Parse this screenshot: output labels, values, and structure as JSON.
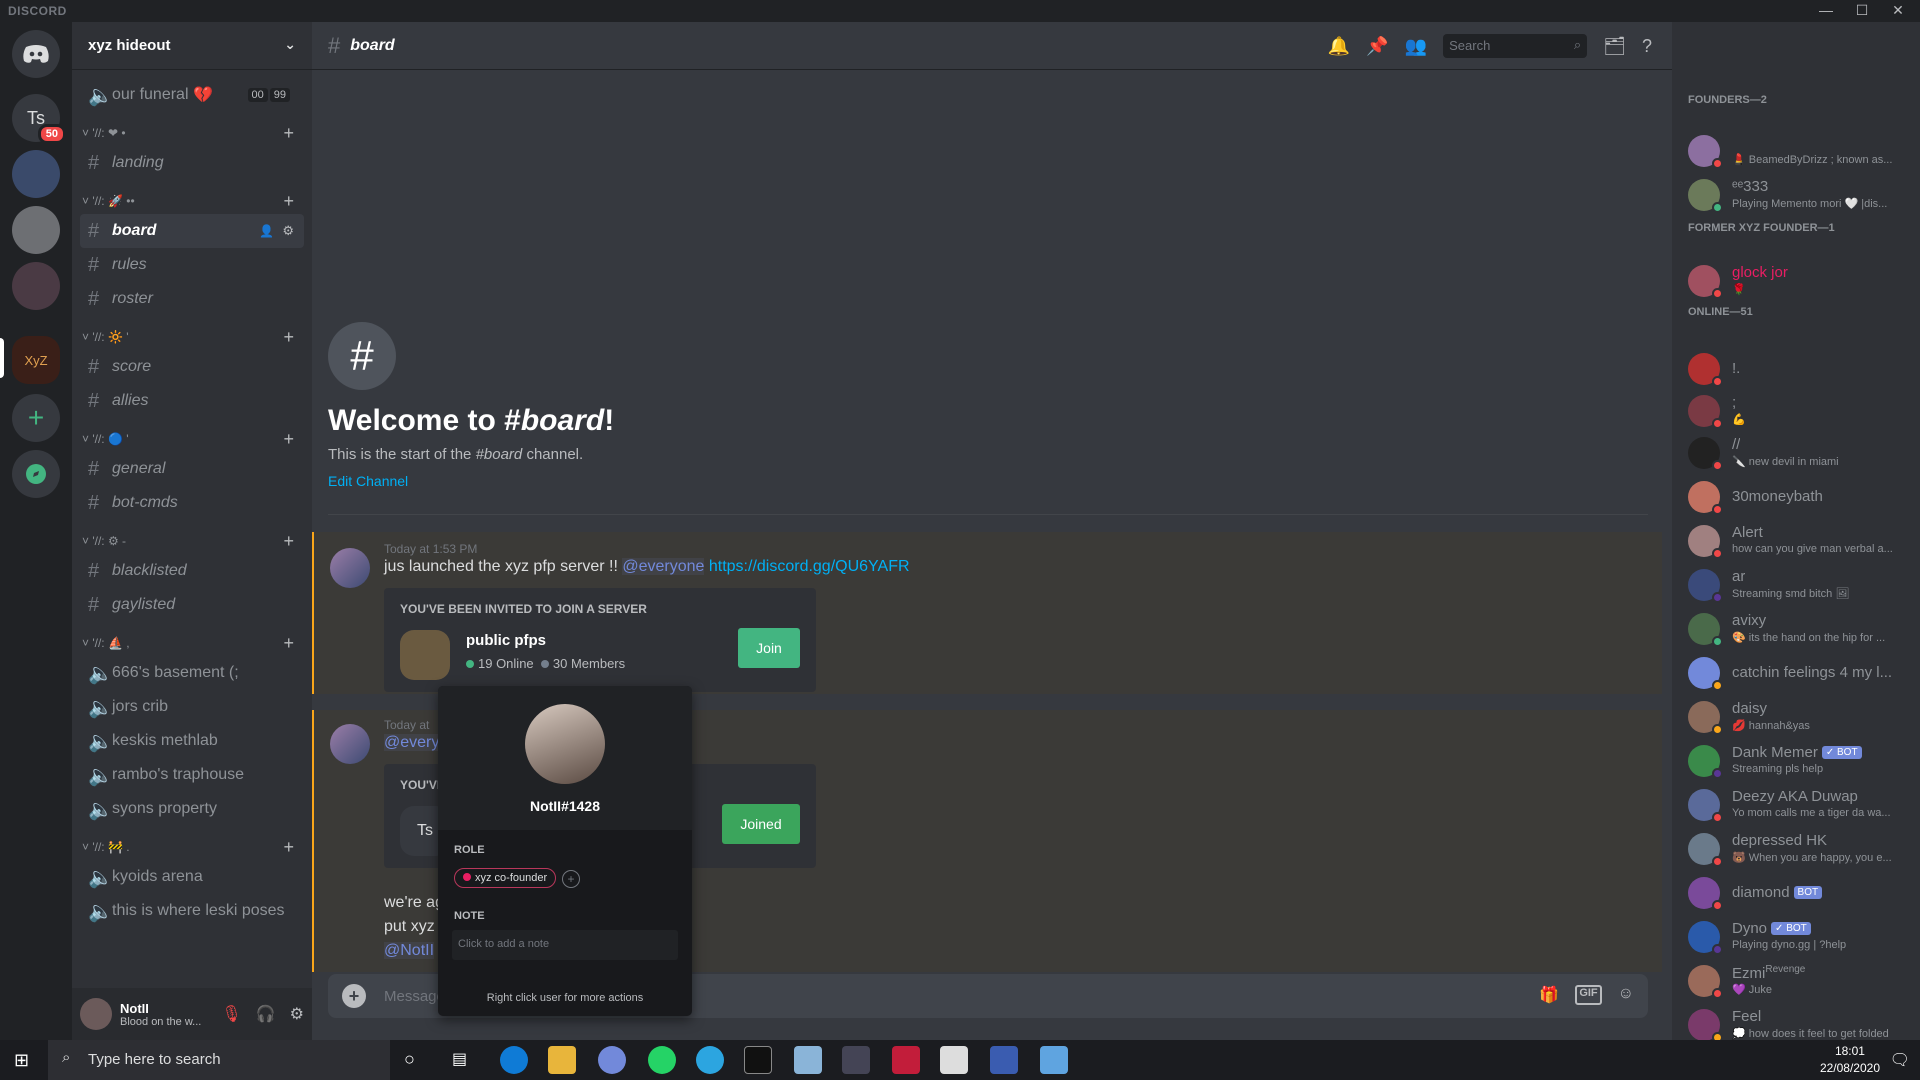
{
  "titlebar": {
    "brand": "DISCORD",
    "min": "—",
    "max": "☐",
    "close": "✕"
  },
  "guilds": {
    "home_icon": "discord-logo",
    "ts_label": "Ts",
    "ts_badge": "50",
    "add": "+",
    "explore": "⌖"
  },
  "server": {
    "name": "xyz hideout",
    "chevron": "⌄"
  },
  "channels": {
    "top_voice": {
      "name": "our funeral",
      "emoji": "💔",
      "counts": [
        "00",
        "99"
      ]
    },
    "cat1": {
      "label": "˅ '//: ❤ •",
      "plus": "+"
    },
    "landing": "landing",
    "cat2": {
      "label": "˅ '//: 🚀 ••",
      "plus": "+"
    },
    "board": "board",
    "rules": "rules",
    "roster": "roster",
    "cat3": {
      "label": "˅ '//: 🔆 '",
      "plus": "+"
    },
    "score": "score",
    "allies": "allies",
    "cat4": {
      "label": "˅ '//: 🔵 '",
      "plus": "+"
    },
    "general": "general",
    "botcmds": "bot-cmds",
    "cat5": {
      "label": "˅ '//: ⚙ -",
      "plus": "+"
    },
    "blacklisted": "blacklisted",
    "gaylisted": "gaylisted",
    "cat6": {
      "label": "˅ '//: ⛵ ,",
      "plus": "+"
    },
    "v1": "666's basement (;",
    "v2": "jors crib",
    "v3": "keskis methlab",
    "v4": "rambo's traphouse",
    "v5": "syons property",
    "cat7": {
      "label": "˅ '//: 🚧 .",
      "plus": "+"
    },
    "v6": "kyoids arena",
    "v7": "this is where leski poses"
  },
  "user": {
    "name": "NotII",
    "status": "Blood on the w..."
  },
  "header": {
    "hash": "#",
    "channel": "board",
    "search_placeholder": "Search"
  },
  "welcome": {
    "hash": "#",
    "title_pre": "Welcome to #",
    "title_ch": "board",
    "title_post": "!",
    "sub_pre": "This is the start of the ",
    "sub_ch": "#board",
    "sub_post": " channel.",
    "edit": "Edit Channel"
  },
  "msg1": {
    "time": "Today at 1:53 PM",
    "text": "jus launched the xyz pfp server !! ",
    "mention": "@everyone",
    "link": "https://discord.gg/QU6YAFR",
    "invite": {
      "label": "YOU'VE BEEN INVITED TO JOIN A SERVER",
      "name": "public pfps",
      "online": "19 Online",
      "members": "30 Members",
      "button": "Join"
    }
  },
  "msg2": {
    "time": "Today at",
    "mention": "@everyo",
    "invite_label": "YOU'VI",
    "server_initials": "Ts",
    "button": "Joined",
    "lines": [
      "we're ag",
      "put xyz a"
    ],
    "mention2": "@NotII"
  },
  "composer": {
    "placeholder": "Message",
    "plus": "+",
    "gif": "GIF"
  },
  "popout": {
    "username": "NotII#1428",
    "role_heading": "ROLE",
    "role": "xyz co-founder",
    "note_heading": "NOTE",
    "note_placeholder": "Click to add a note",
    "hint": "Right click user for more actions"
  },
  "members": {
    "h1": "FOUNDERS—2",
    "h2": "FORMER XYZ FOUNDER—1",
    "h3": "ONLINE—51",
    "list": [
      {
        "name": "",
        "activity": "💄 BeamedByDrizz ; known as..."
      },
      {
        "name": "ᵉᵉ333",
        "activity": "Playing Memento mori 🤍 |dis..."
      },
      {
        "name": "glock jor",
        "activity": "🌹"
      },
      {
        "name": "!.",
        "activity": ""
      },
      {
        "name": ";",
        "activity": "💪"
      },
      {
        "name": "//",
        "activity": "🔪 new devil in miami"
      },
      {
        "name": "30moneybath",
        "activity": ""
      },
      {
        "name": "Alert",
        "activity": "how can you give man verbal a..."
      },
      {
        "name": "ar",
        "activity": "Streaming smd bitch 🖼"
      },
      {
        "name": "avixy",
        "activity": "🎨 its the hand on the hip for ..."
      },
      {
        "name": "catchin feelings 4 my l...",
        "activity": ""
      },
      {
        "name": "daisy",
        "activity": "💋 hannah&yas"
      },
      {
        "name": "Dank Memer",
        "activity": "Streaming pls help",
        "bot": "✓ BOT"
      },
      {
        "name": "Deezy AKA Duwap",
        "activity": "Yo mom calls me a tiger da wa..."
      },
      {
        "name": "depressed HK",
        "activity": "🐻 When you are happy, you e..."
      },
      {
        "name": "diamond",
        "activity": "",
        "bot": "BOT"
      },
      {
        "name": "Dyno",
        "activity": "Playing dyno.gg | ?help",
        "bot": "✓ BOT"
      },
      {
        "name": "Ezmi",
        "activity": "💜 Juke",
        "tag": "Revenge"
      },
      {
        "name": "Feel",
        "activity": "💭 how does it feel to get folded"
      }
    ]
  },
  "taskbar": {
    "search_placeholder": "Type here to search",
    "time": "18:01",
    "date": "22/08/2020"
  },
  "colors": {
    "accent": "#7289da",
    "join": "#43b581",
    "dnd": "#f04747",
    "highlight": "#faa61a"
  }
}
